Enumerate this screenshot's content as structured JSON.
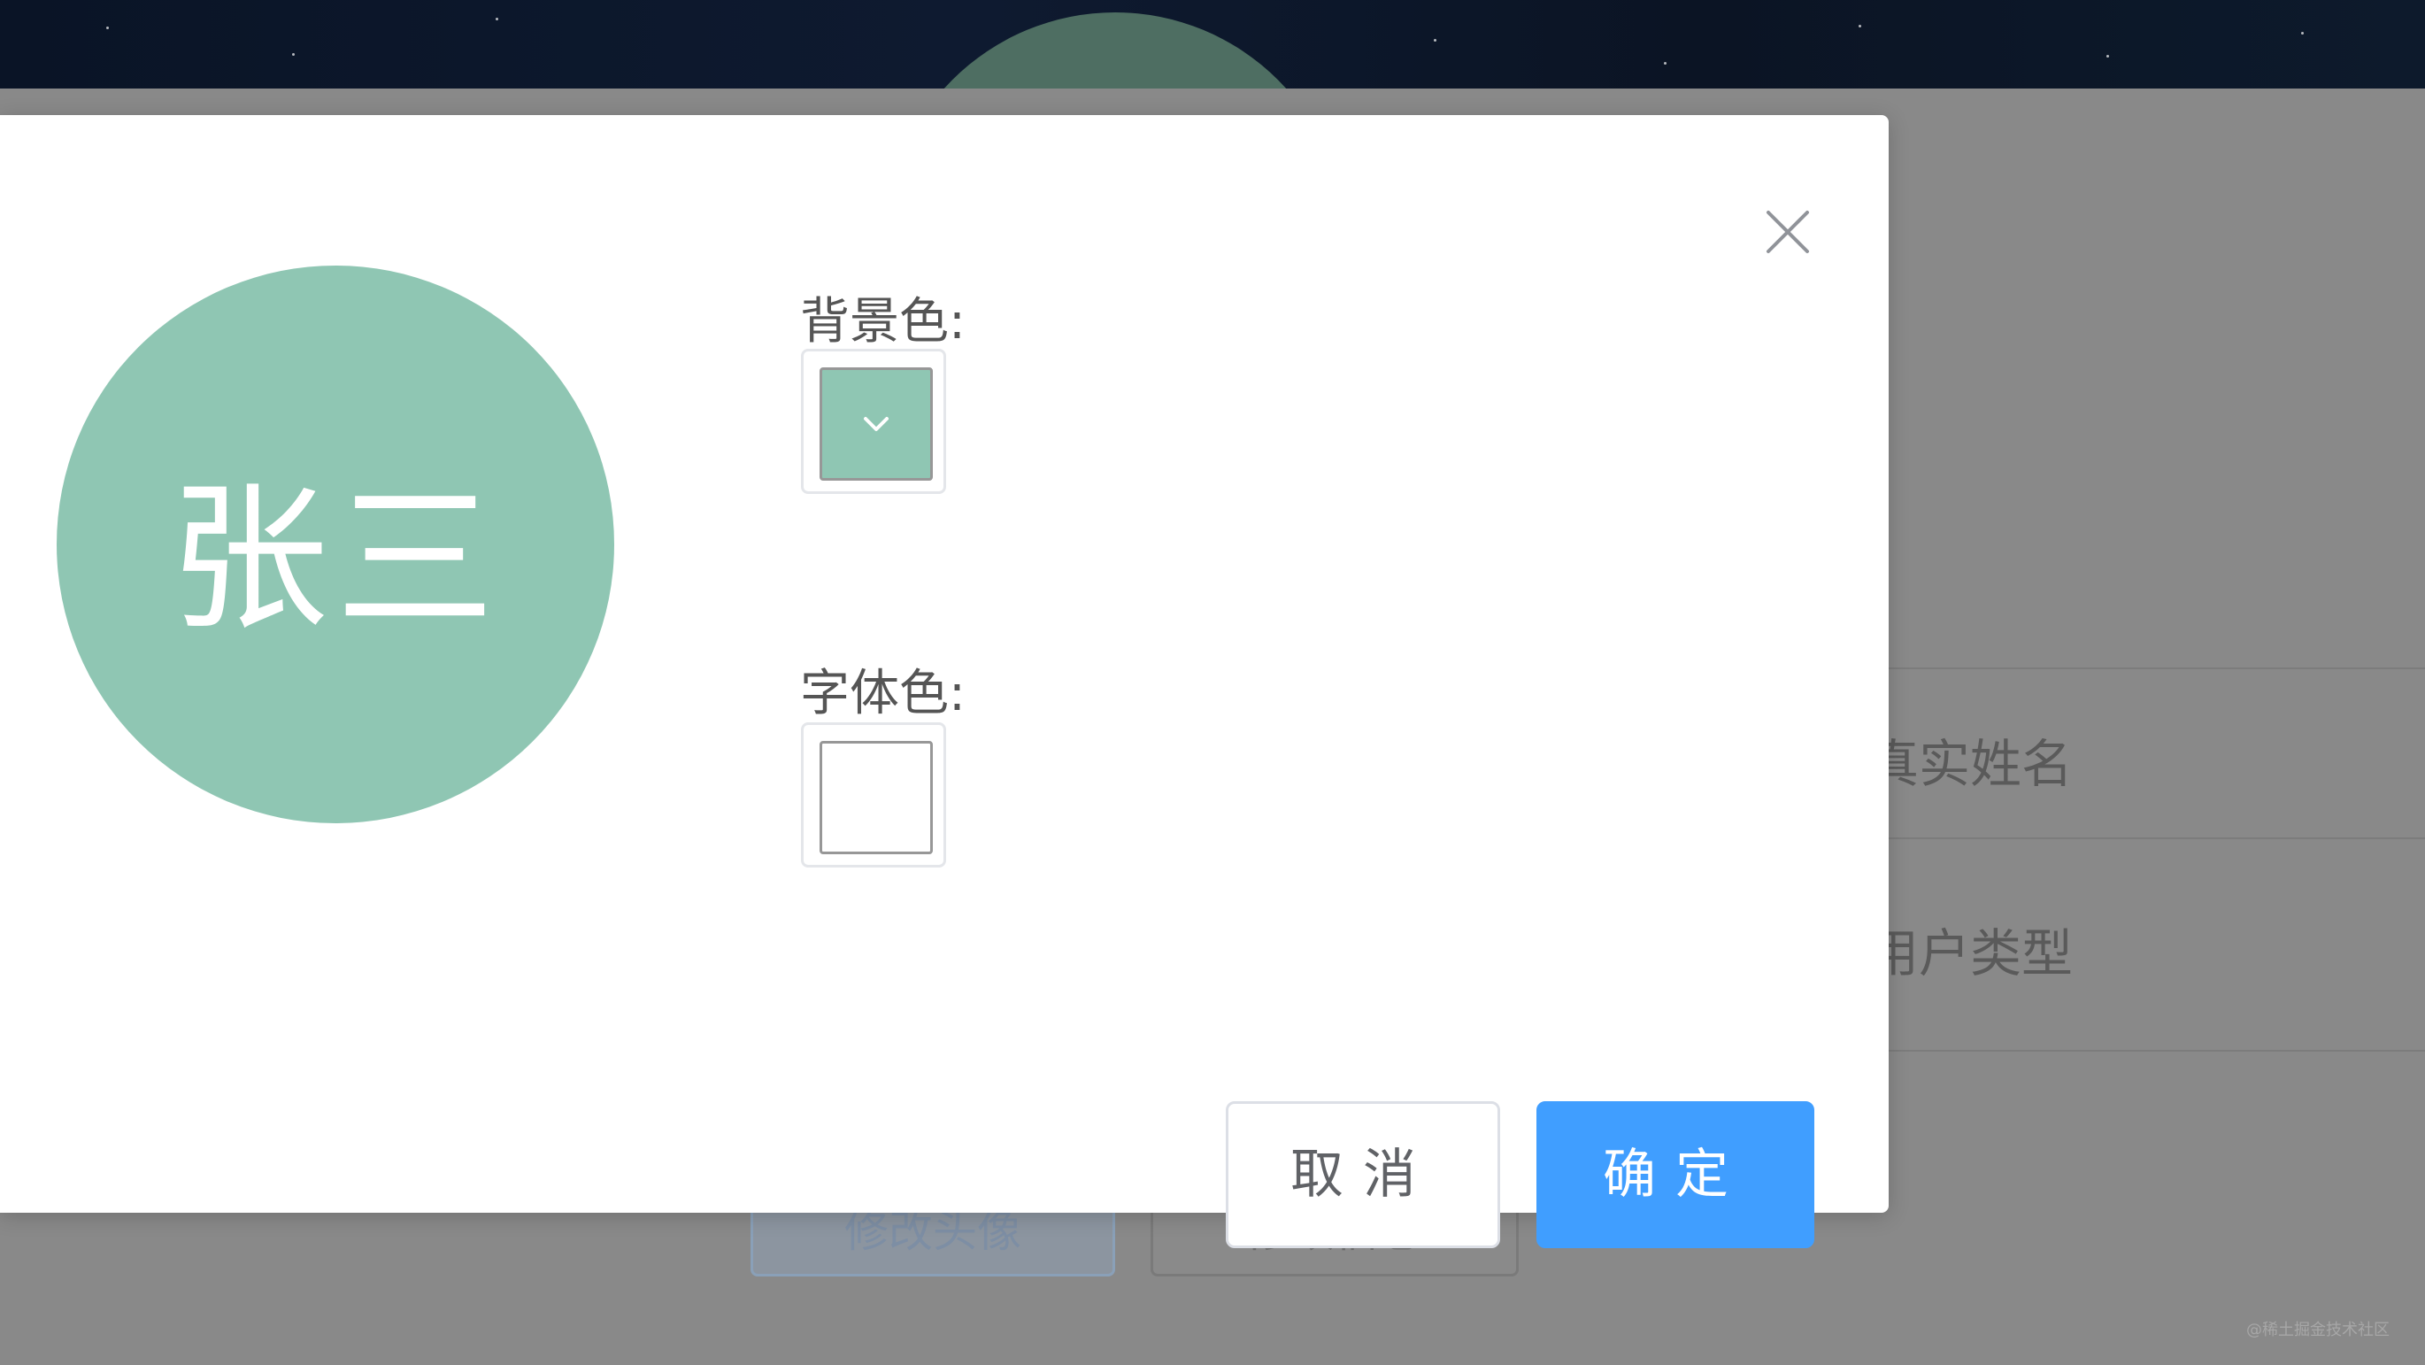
{
  "background_page": {
    "rows": [
      {
        "label": "真实姓名"
      },
      {
        "label": "用户类型"
      }
    ],
    "buttons": [
      {
        "label": "修改头像"
      },
      {
        "label": "修改信息"
      }
    ],
    "watermark": "@稀土掘金技术社区"
  },
  "dialog": {
    "avatar": {
      "name": "张三",
      "background_color": "#8fc6b3",
      "text_color": "#ffffff"
    },
    "background_color_field": {
      "label": "背景色:",
      "value": "#8fc6b3"
    },
    "font_color_field": {
      "label": "字体色:",
      "value": "#ffffff"
    },
    "cancel_label": "取消",
    "confirm_label": "确定",
    "close_icon": "close-icon",
    "dropdown_icon": "chevron-down-icon"
  },
  "colors": {
    "primary": "#409eff",
    "dialog_bg": "#ffffff",
    "overlay_bg": "#898989"
  }
}
